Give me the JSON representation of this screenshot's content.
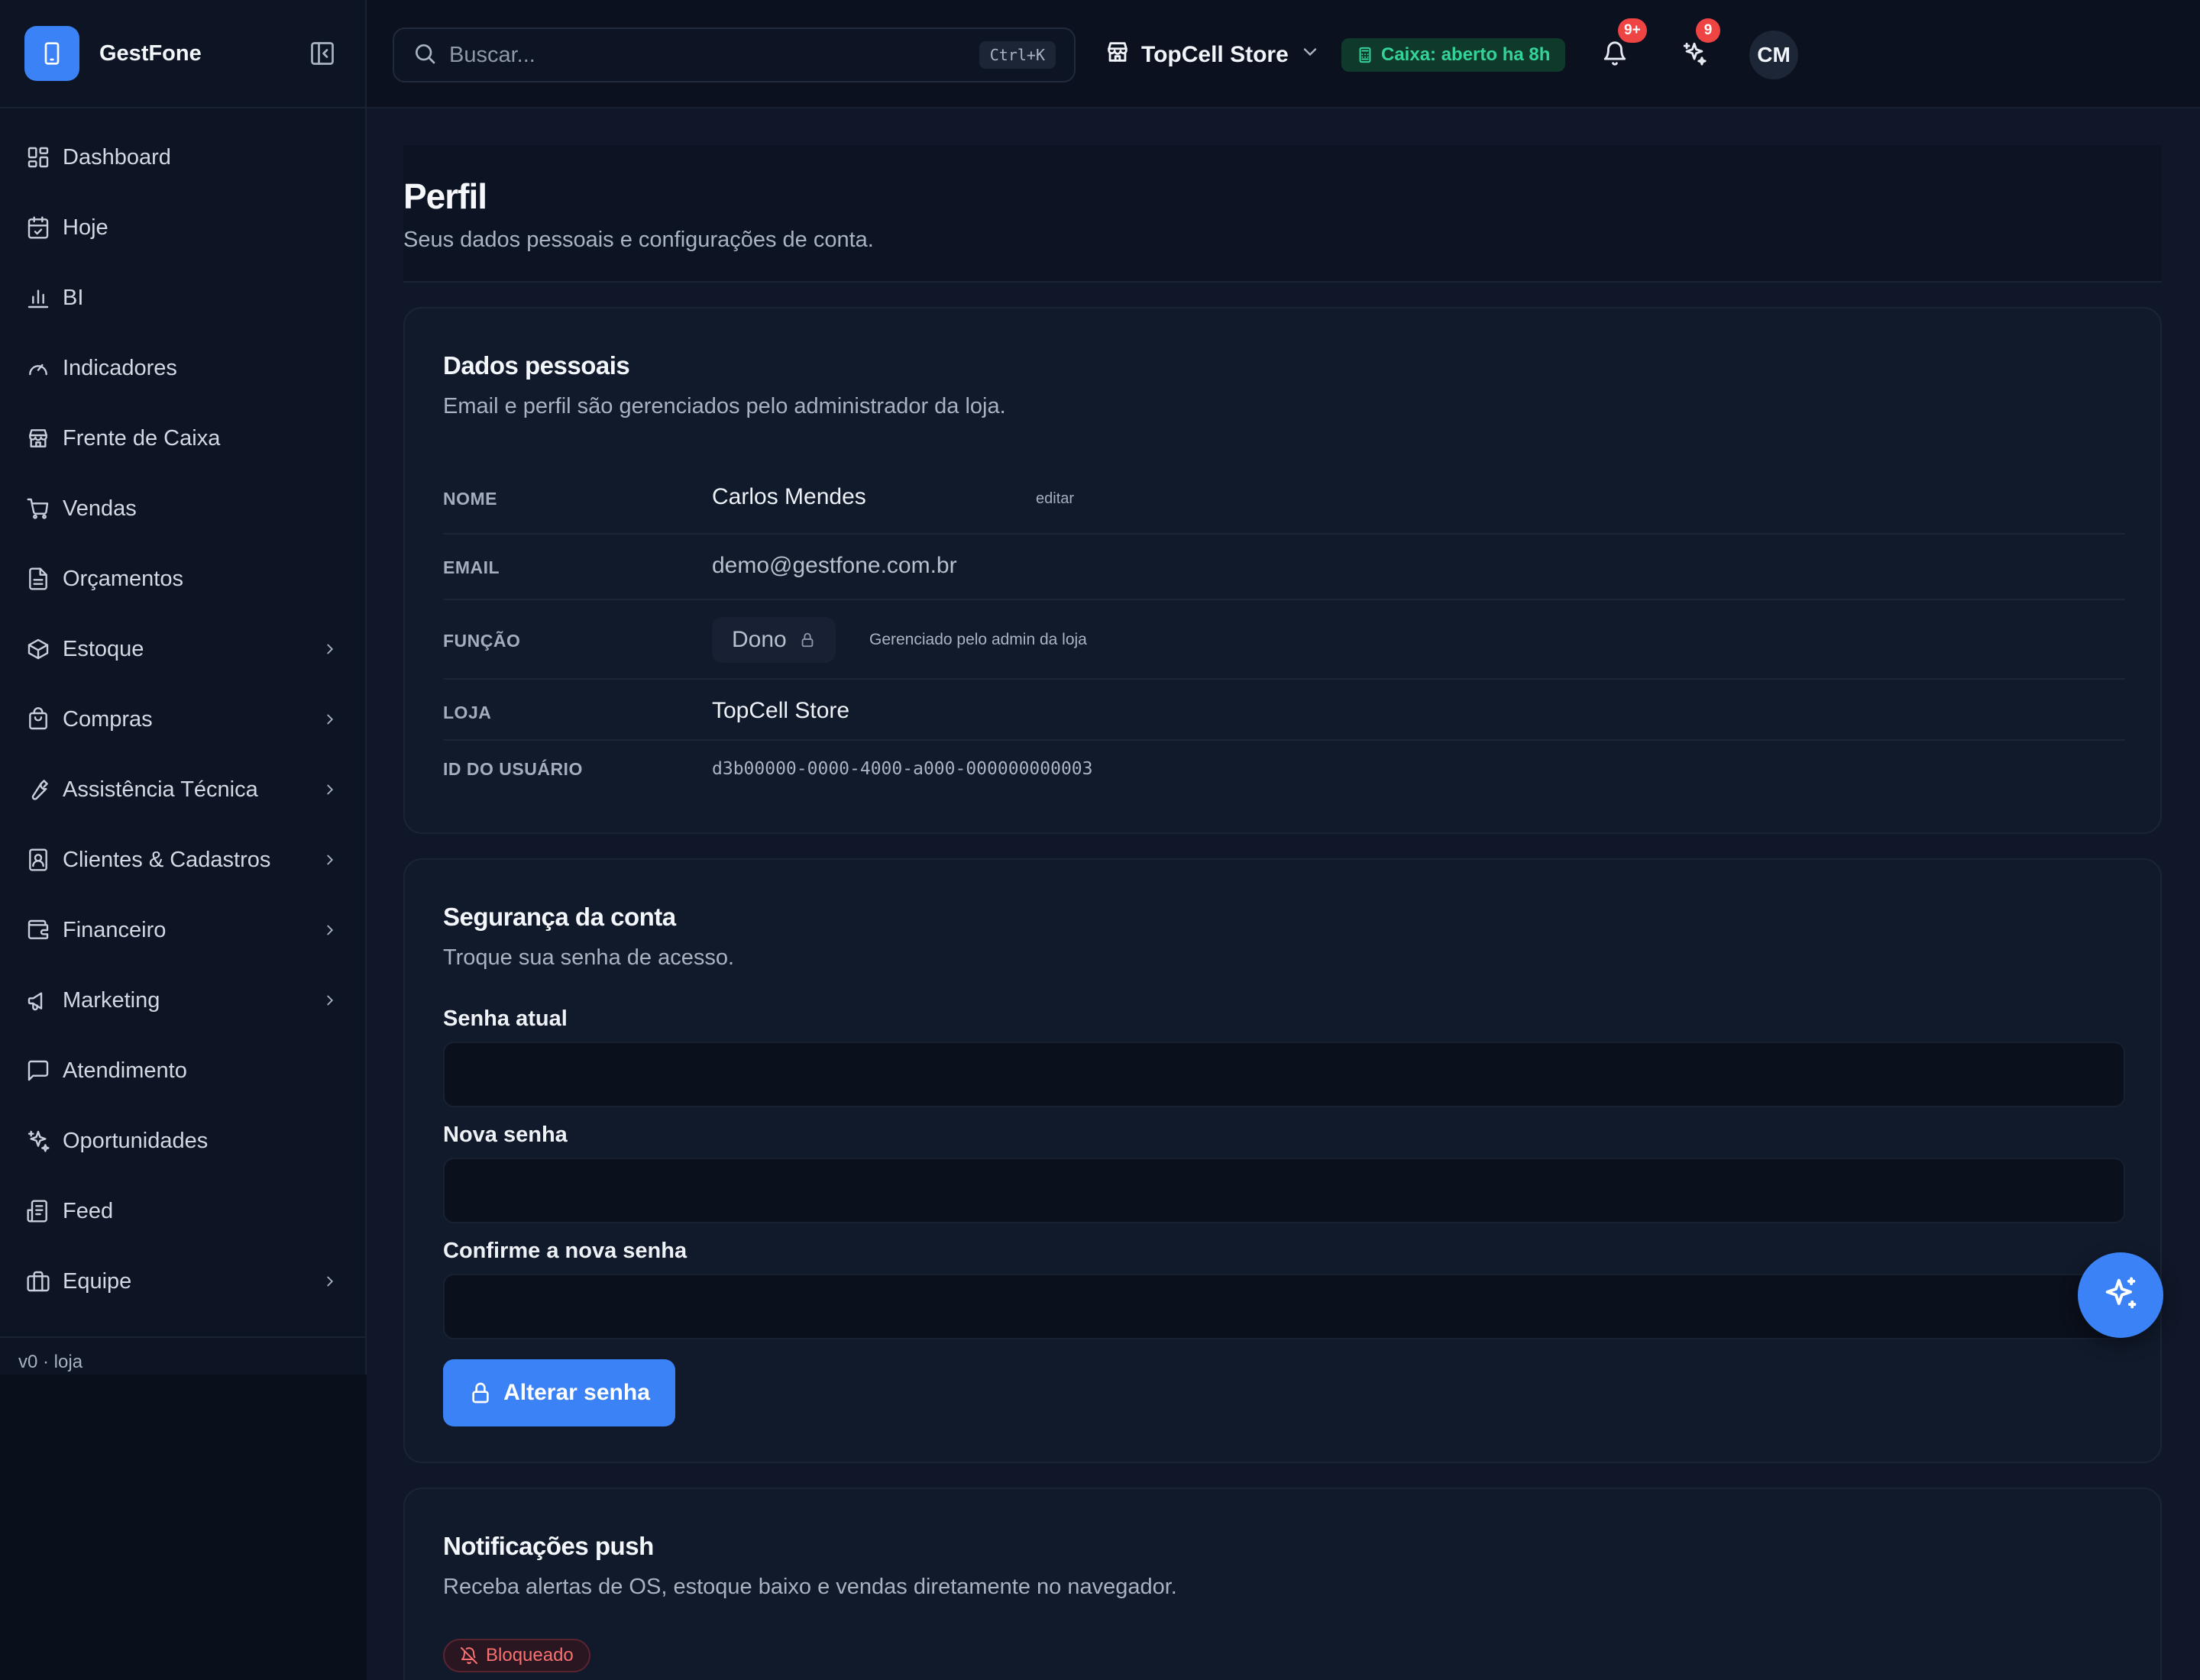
{
  "brand": {
    "name": "GestFone"
  },
  "sidebar": {
    "items": [
      {
        "label": "Dashboard",
        "icon": "dashboard-icon",
        "expandable": false
      },
      {
        "label": "Hoje",
        "icon": "calendar-icon",
        "expandable": false
      },
      {
        "label": "BI",
        "icon": "bar-chart-icon",
        "expandable": false
      },
      {
        "label": "Indicadores",
        "icon": "gauge-icon",
        "expandable": false
      },
      {
        "label": "Frente de Caixa",
        "icon": "store-icon",
        "expandable": false
      },
      {
        "label": "Vendas",
        "icon": "cart-icon",
        "expandable": false
      },
      {
        "label": "Orçamentos",
        "icon": "document-icon",
        "expandable": false
      },
      {
        "label": "Estoque",
        "icon": "package-icon",
        "expandable": true
      },
      {
        "label": "Compras",
        "icon": "shopping-bag-icon",
        "expandable": true
      },
      {
        "label": "Assistência Técnica",
        "icon": "wrench-icon",
        "expandable": true
      },
      {
        "label": "Clientes & Cadastros",
        "icon": "contact-card-icon",
        "expandable": true
      },
      {
        "label": "Financeiro",
        "icon": "wallet-icon",
        "expandable": true
      },
      {
        "label": "Marketing",
        "icon": "megaphone-icon",
        "expandable": true
      },
      {
        "label": "Atendimento",
        "icon": "chat-icon",
        "expandable": false
      },
      {
        "label": "Oportunidades",
        "icon": "sparkles-icon",
        "expandable": false
      },
      {
        "label": "Feed",
        "icon": "newspaper-icon",
        "expandable": false
      },
      {
        "label": "Equipe",
        "icon": "briefcase-icon",
        "expandable": true
      }
    ],
    "version": "v0 · loja"
  },
  "topbar": {
    "search_placeholder": "Buscar...",
    "search_shortcut": "Ctrl+K",
    "store_name": "TopCell Store",
    "caixa_status": "Caixa: aberto ha 8h",
    "notifications_badge": "9+",
    "ai_badge": "9",
    "avatar_initials": "CM"
  },
  "page": {
    "title": "Perfil",
    "subtitle": "Seus dados pessoais e configurações de conta."
  },
  "personal": {
    "title": "Dados pessoais",
    "subtitle": "Email e perfil são gerenciados pelo administrador da loja.",
    "name_label": "NOME",
    "name_value": "Carlos Mendes",
    "edit_label": "editar",
    "email_label": "EMAIL",
    "email_value": "demo@gestfone.com.br",
    "role_label": "FUNÇÃO",
    "role_value": "Dono",
    "role_note": "Gerenciado pelo admin da loja",
    "store_label": "LOJA",
    "store_value": "TopCell Store",
    "id_label": "ID DO USUÁRIO",
    "id_value": "d3b00000-0000-4000-a000-000000000003"
  },
  "security": {
    "title": "Segurança da conta",
    "subtitle": "Troque sua senha de acesso.",
    "current_label": "Senha atual",
    "new_label": "Nova senha",
    "confirm_label": "Confirme a nova senha",
    "submit_label": "Alterar senha"
  },
  "push": {
    "title": "Notificações push",
    "subtitle": "Receba alertas de OS, estoque baixo e vendas diretamente no navegador.",
    "status": "Bloqueado"
  },
  "colors": {
    "accent": "#3b82f6",
    "success": "#34d399",
    "danger": "#ef4444",
    "background": "#0f1728"
  }
}
